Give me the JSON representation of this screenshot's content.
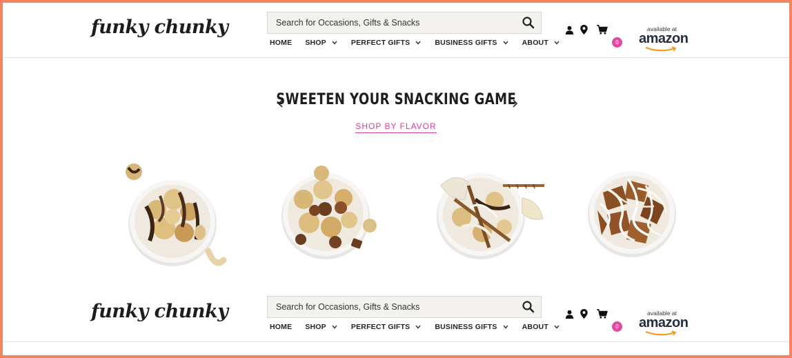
{
  "header": {
    "logo_text": "funky chunky",
    "logo_reg": "®",
    "search_placeholder": "Search for Occasions, Gifts & Snacks",
    "nav": [
      {
        "label": "HOME"
      },
      {
        "label": "SHOP"
      },
      {
        "label": "PERFECT GIFTS"
      },
      {
        "label": "BUSINESS GIFTS"
      },
      {
        "label": "ABOUT"
      }
    ],
    "cart_count": "0",
    "amazon_top": "available at",
    "amazon_word": "amazon"
  },
  "hero": {
    "title": "SWEETEN YOUR SNACKING GAME",
    "link": "SHOP BY FLAVOR"
  },
  "products": [
    {
      "name": "Popcorn mix with chocolate, caramel and nuts"
    },
    {
      "name": "Popcorn mix with peanut butter cups"
    },
    {
      "name": "Popcorn mix with pretzels and chips"
    },
    {
      "name": "Chocolate drizzled pretzel bites"
    }
  ],
  "colors": {
    "accent": "#d5409a",
    "badge": "#e14aa0",
    "frame": "#f4845f",
    "text": "#1e1e1e"
  },
  "icons": [
    "search-icon",
    "user-icon",
    "location-pin-icon",
    "cart-icon",
    "chevron-down-icon",
    "chevron-left-icon",
    "chevron-right-icon"
  ]
}
